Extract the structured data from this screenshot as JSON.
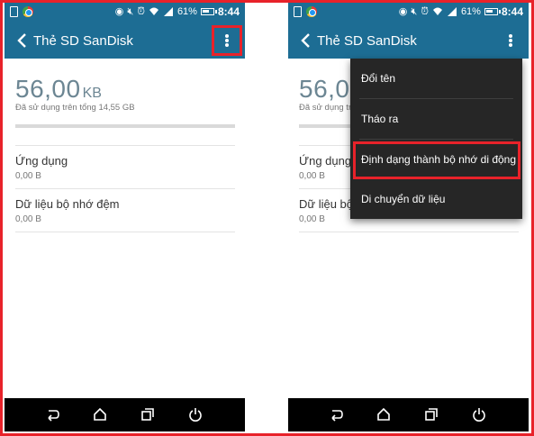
{
  "status_bar": {
    "battery_percent": "61%",
    "time": "8:44",
    "icons": [
      "sim-card-icon",
      "chrome-icon",
      "nfc-icon",
      "mute-icon",
      "alarm-icon",
      "wifi-icon",
      "signal-icon",
      "battery-icon"
    ]
  },
  "toolbar": {
    "title": "Thẻ SD SanDisk",
    "back_icon": "back-arrow-icon",
    "more_icon": "more-vert-icon"
  },
  "storage": {
    "used_value": "56,00",
    "used_unit": "KB",
    "used_subtitle": "Đã sử dụng trên tổng 14,55 GB",
    "usage_fraction": 0.0
  },
  "categories": [
    {
      "title": "Ứng dụng",
      "value": "0,00 B"
    },
    {
      "title": "Dữ liệu bộ nhớ đệm",
      "value": "0,00 B"
    }
  ],
  "overflow_menu": {
    "items": [
      {
        "label": "Đổi tên"
      },
      {
        "label": "Tháo ra"
      },
      {
        "label": "Định dạng thành bộ nhớ di động"
      },
      {
        "label": "Di chuyển dữ liệu"
      }
    ],
    "highlighted_index": 2
  },
  "nav_bar": {
    "icons": [
      "back-nav-icon",
      "home-nav-icon",
      "recents-nav-icon",
      "power-nav-icon"
    ]
  },
  "colors": {
    "toolbar": "#1d6d94",
    "highlight": "#e8222a",
    "menu_background": "#262626",
    "nav_background": "#000000"
  }
}
